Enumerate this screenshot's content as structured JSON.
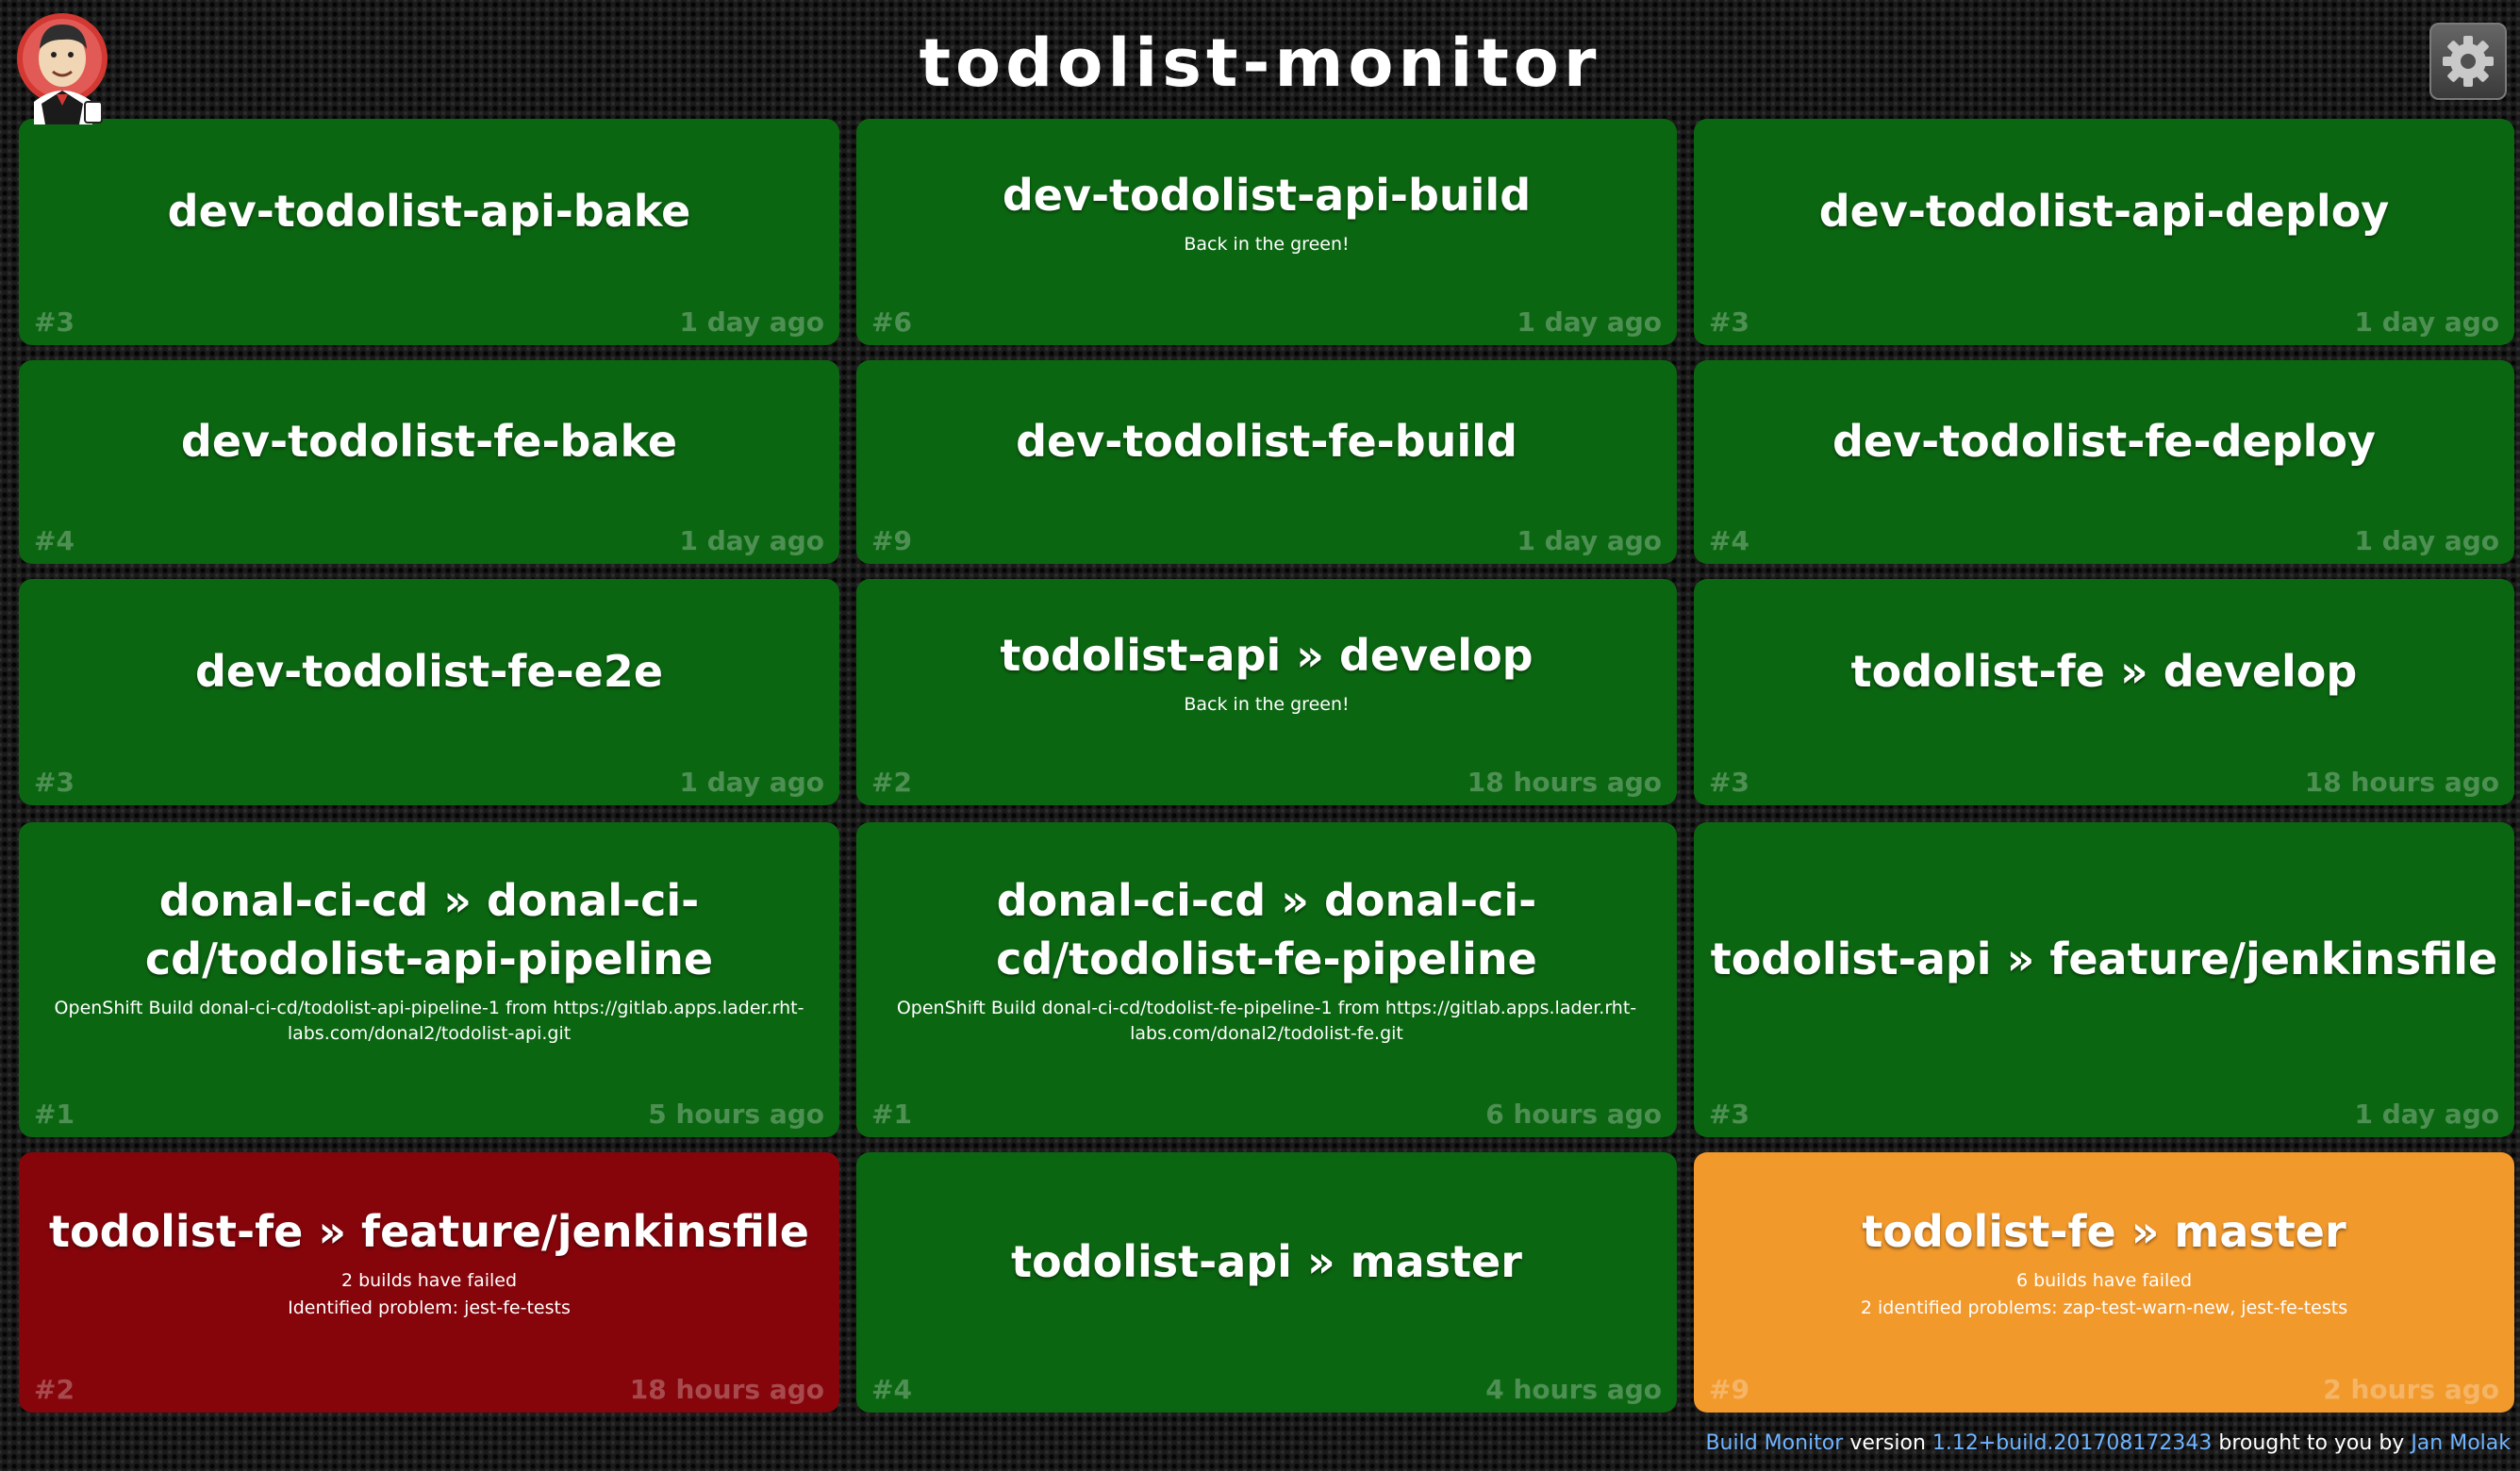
{
  "header": {
    "title": "todolist-monitor"
  },
  "icons": {
    "logo": "jenkins-butler-logo",
    "settings": "gear-icon"
  },
  "colors": {
    "success": "#0b6611",
    "failure": "#86050b",
    "unstable": "#f2992c",
    "link": "#6fb4ff"
  },
  "tiles": [
    {
      "name": "dev-todolist-api-bake",
      "build": "#3",
      "time": "1 day ago",
      "status": "success"
    },
    {
      "name": "dev-todolist-api-build",
      "message": "Back in the green!",
      "build": "#6",
      "time": "1 day ago",
      "status": "success"
    },
    {
      "name": "dev-todolist-api-deploy",
      "build": "#3",
      "time": "1 day ago",
      "status": "success"
    },
    {
      "name": "dev-todolist-fe-bake",
      "build": "#4",
      "time": "1 day ago",
      "status": "success"
    },
    {
      "name": "dev-todolist-fe-build",
      "build": "#9",
      "time": "1 day ago",
      "status": "success"
    },
    {
      "name": "dev-todolist-fe-deploy",
      "build": "#4",
      "time": "1 day ago",
      "status": "success"
    },
    {
      "name": "dev-todolist-fe-e2e",
      "build": "#3",
      "time": "1 day ago",
      "status": "success"
    },
    {
      "name": "todolist-api » develop",
      "message": "Back in the green!",
      "build": "#2",
      "time": "18 hours ago",
      "status": "success"
    },
    {
      "name": "todolist-fe » develop",
      "build": "#3",
      "time": "18 hours ago",
      "status": "success"
    },
    {
      "name": "donal-ci-cd » donal-ci-cd/todolist-api-pipeline",
      "message": "OpenShift Build donal-ci-cd/todolist-api-pipeline-1 from https://gitlab.apps.lader.rht-labs.com/donal2/todolist-api.git",
      "build": "#1",
      "time": "5 hours ago",
      "status": "success"
    },
    {
      "name": "donal-ci-cd » donal-ci-cd/todolist-fe-pipeline",
      "message": "OpenShift Build donal-ci-cd/todolist-fe-pipeline-1 from https://gitlab.apps.lader.rht-labs.com/donal2/todolist-fe.git",
      "build": "#1",
      "time": "6 hours ago",
      "status": "success"
    },
    {
      "name": "todolist-api » feature/jenkinsfile",
      "build": "#3",
      "time": "1 day ago",
      "status": "success"
    },
    {
      "name": "todolist-fe » feature/jenkinsfile",
      "message": "2 builds have failed",
      "message2": "Identified problem: jest-fe-tests",
      "build": "#2",
      "time": "18 hours ago",
      "status": "failing"
    },
    {
      "name": "todolist-api » master",
      "build": "#4",
      "time": "4 hours ago",
      "status": "success"
    },
    {
      "name": "todolist-fe » master",
      "message": "6 builds have failed",
      "message2": "2 identified problems: zap-test-warn-new,  jest-fe-tests",
      "build": "#9",
      "time": "2 hours ago",
      "status": "unstable"
    }
  ],
  "footer": {
    "product": "Build Monitor",
    "version_label": "version",
    "version": "1.12+build.201708172343",
    "by_label": "brought to you by",
    "author": "Jan Molak"
  }
}
